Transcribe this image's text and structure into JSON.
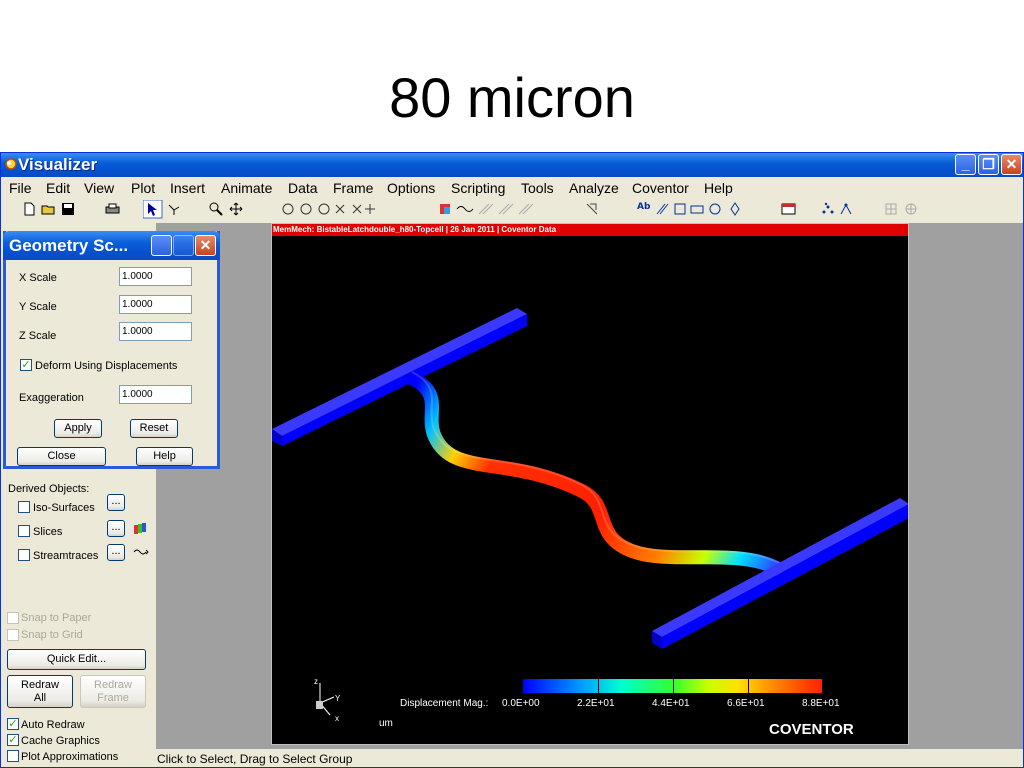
{
  "slide": {
    "title": "80 micron"
  },
  "window": {
    "title": "Visualizer",
    "min": "_",
    "max": "❐",
    "close": "✕"
  },
  "menu": [
    "File",
    "Edit",
    "View",
    "Plot",
    "Insert",
    "Animate",
    "Data",
    "Frame",
    "Options",
    "Scripting",
    "Tools",
    "Analyze",
    "Coventor",
    "Help"
  ],
  "toolbar": {
    "text_tool": "Ab"
  },
  "viewport": {
    "header": "MemMech: BistableLatchdouble_h80-Topcell | 26 Jan 2011 | Coventor Data",
    "legend_label": "Displacement Mag.:",
    "legend_ticks": [
      "0.0E+00",
      "2.2E+01",
      "4.4E+01",
      "6.6E+01",
      "8.8E+01"
    ],
    "unit": "um",
    "brand": "COVENTOR",
    "axes": {
      "z": "z",
      "y": "Y",
      "x": "x"
    }
  },
  "dialog": {
    "title": "Geometry Sc...",
    "x_label": "X Scale",
    "x_value": "1.0000",
    "y_label": "Y Scale",
    "y_value": "1.0000",
    "z_label": "Z Scale",
    "z_value": "1.0000",
    "deform_label": "Deform Using Displacements",
    "deform_checked": true,
    "exag_label": "Exaggeration",
    "exag_value": "1.0000",
    "apply": "Apply",
    "reset": "Reset",
    "close": "Close",
    "help": "Help"
  },
  "left_panel": {
    "derived_label": "Derived Objects:",
    "iso": "Iso-Surfaces",
    "slices": "Slices",
    "streamtraces": "Streamtraces",
    "dots": "...",
    "snap_paper": "Snap to Paper",
    "snap_grid": "Snap to Grid",
    "quick_edit": "Quick Edit...",
    "redraw_all_1": "Redraw",
    "redraw_all_2": "All",
    "redraw_frame_1": "Redraw",
    "redraw_frame_2": "Frame",
    "auto_redraw": "Auto Redraw",
    "cache_graphics": "Cache Graphics",
    "plot_approx": "Plot Approximations"
  },
  "status": "Click to Select, Drag to Select Group",
  "colors": {
    "titlebar": "#0551d1",
    "viewport_header": "#e00000",
    "beam": "#0000ff"
  }
}
